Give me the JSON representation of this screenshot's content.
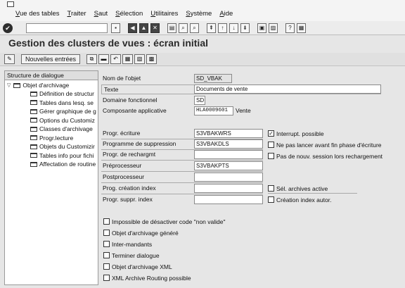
{
  "menu": [
    "Vue des tables",
    "Traiter",
    "Saut",
    "Sélection",
    "Utilitaires",
    "Système",
    "Aide"
  ],
  "page_title": "Gestion des clusters de vues : écran initial",
  "app_toolbar": {
    "new_entries_label": "Nouvelles entrées"
  },
  "sidebar": {
    "header": "Structure de dialogue",
    "root": "Objet d'archivage",
    "items": [
      "Définition de structur",
      "Tables dans lesq. se",
      "Gérer graphique de g",
      "Options du Customiz",
      "Classes d'archivage",
      "Progr.lecture",
      "Objets du Customizir",
      "Tables info pour fichi",
      "Affectation de routine"
    ]
  },
  "form": {
    "object_name": {
      "label": "Nom de l'objet",
      "value": "SD_VBAK"
    },
    "text": {
      "label": "Texte",
      "value": "Documents de vente"
    },
    "domain": {
      "label": "Domaine fonctionnel",
      "value": "SD"
    },
    "app_component": {
      "label": "Composante applicative",
      "value": "HLA0009601",
      "desc": "Vente"
    },
    "write_prog": {
      "label": "Progr. écriture",
      "value": "S3VBAKWRS"
    },
    "delete_prog": {
      "label": "Programme de suppression",
      "value": "S3VBAKDLS"
    },
    "reload_prog": {
      "label": "Progr. de rechargmt",
      "value": ""
    },
    "preprocessor": {
      "label": "Préprocesseur",
      "value": "S3VBAKPTS"
    },
    "postprocessor": {
      "label": "Postprocesseur",
      "value": ""
    },
    "index_build": {
      "label": "Prog. création index",
      "value": ""
    },
    "index_delete": {
      "label": "Progr. suppr. index",
      "value": ""
    },
    "right_checks": [
      {
        "label": "Interrupt. possible",
        "checked": true
      },
      {
        "label": "Ne pas lancer avant fin phase d'écriture",
        "checked": false
      },
      {
        "label": "Pas de nouv. session lors rechargement",
        "checked": false
      },
      {
        "label": "Sél. archives active",
        "checked": false
      },
      {
        "label": "Création index autor.",
        "checked": false
      }
    ],
    "bottom_checks": [
      {
        "label": "Impossible de désactiver code \"non valide\"",
        "checked": false
      },
      {
        "label": "Objet d'archivage généré",
        "checked": false
      },
      {
        "label": "Inter-mandants",
        "checked": false
      },
      {
        "label": "Terminer dialogue",
        "checked": false
      },
      {
        "label": "Objet d'archivage XML",
        "checked": false
      },
      {
        "label": "XML Archive Routing possible",
        "checked": false
      }
    ]
  },
  "icons": {
    "menu_system": "window-menu-icon",
    "enter": "enter-check-icon",
    "toolbar": [
      "save-icon",
      "back-icon",
      "exit-icon",
      "cancel-icon",
      "print-icon",
      "find-icon",
      "find-next-icon",
      "first-page-icon",
      "prev-page-icon",
      "next-page-icon",
      "last-page-icon",
      "new-session-icon",
      "shortcut-icon",
      "help-icon",
      "layout-icon"
    ]
  }
}
